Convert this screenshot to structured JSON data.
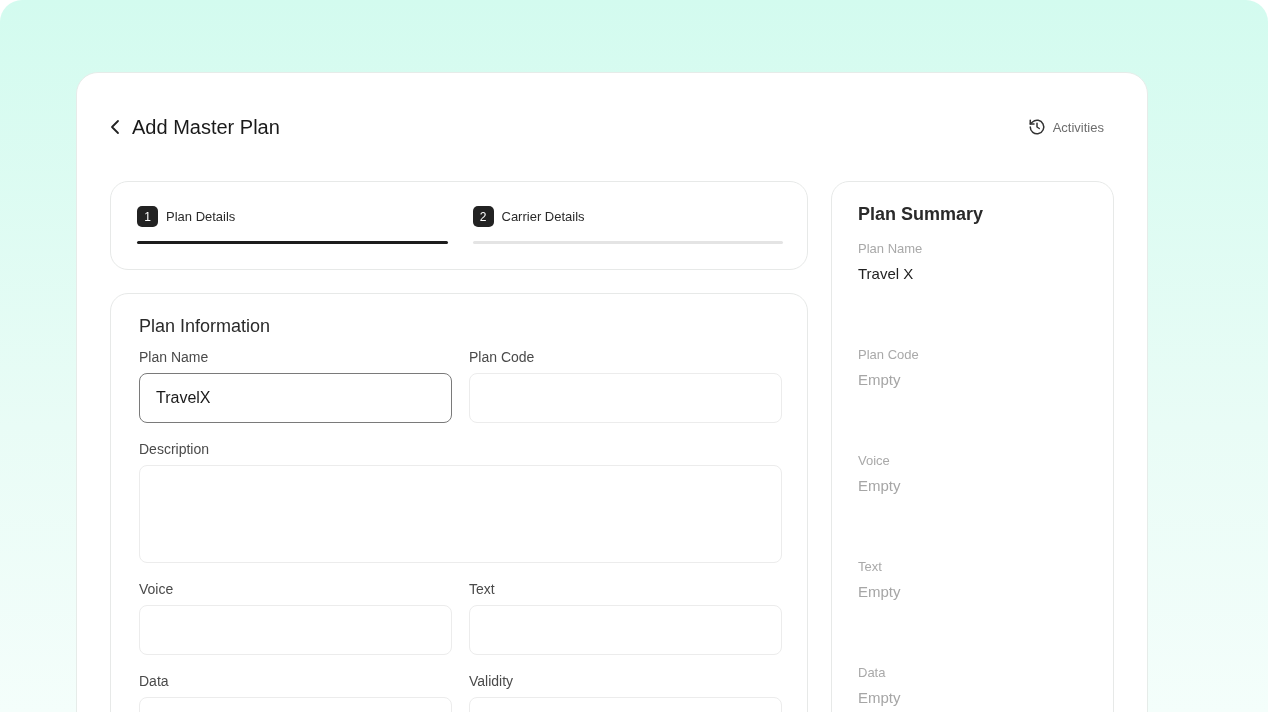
{
  "header": {
    "title": "Add Master Plan",
    "activities": "Activities"
  },
  "steps": [
    {
      "number": "1",
      "label": "Plan Details",
      "selected": true
    },
    {
      "number": "2",
      "label": "Carrier Details",
      "selected": false
    }
  ],
  "form": {
    "title": "Plan Information",
    "fields": [
      {
        "label": "Plan Name",
        "kind": "input",
        "value": "TravelX",
        "focused": true
      },
      {
        "label": "Plan Code",
        "kind": "input",
        "focused": false
      },
      {
        "label": "Description",
        "kind": "textarea",
        "focused": false
      },
      {
        "label": "Voice",
        "kind": "input",
        "focused": false
      },
      {
        "label": "Text",
        "kind": "input",
        "focused": false
      },
      {
        "label": "Data",
        "kind": "input",
        "focused": false
      },
      {
        "label": "Validity",
        "kind": "input",
        "focused": false
      }
    ]
  },
  "summary": {
    "title": "Plan Summary",
    "items": [
      {
        "label": "Plan Name",
        "value": "Travel X",
        "empty": false
      },
      {
        "label": "Plan Code",
        "value": "Empty",
        "empty": true
      },
      {
        "label": "Voice",
        "value": "Empty",
        "empty": true
      },
      {
        "label": "Text",
        "value": "Empty",
        "empty": true
      },
      {
        "label": "Data",
        "value": "Empty",
        "empty": true
      }
    ]
  }
}
